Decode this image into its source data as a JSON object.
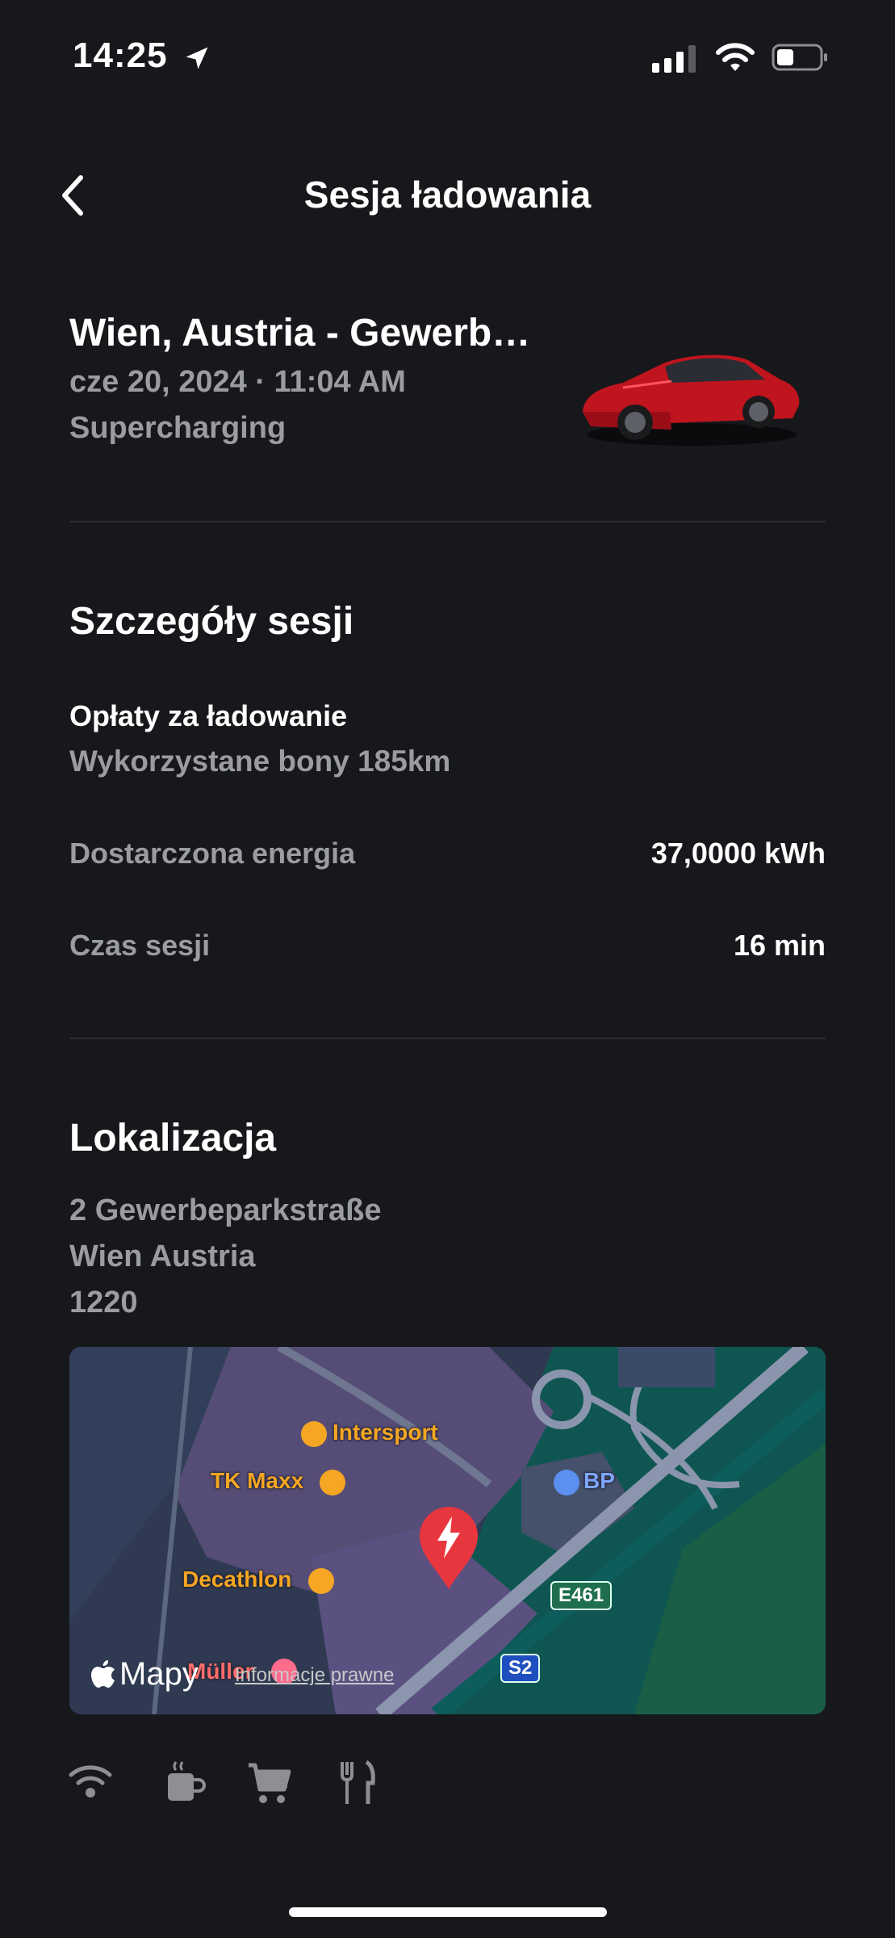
{
  "status_bar": {
    "time": "14:25"
  },
  "header": {
    "title": "Sesja ładowania"
  },
  "summary": {
    "location": "Wien, Austria - Gewerb…",
    "datetime": "cze 20, 2024 · 11:04 AM",
    "type": "Supercharging"
  },
  "session": {
    "title": "Szczegóły sesji",
    "fees_title": "Opłaty za ładowanie",
    "fees_detail": "Wykorzystane bony 185km",
    "rows": [
      {
        "label": "Dostarczona energia",
        "value": "37,0000 kWh"
      },
      {
        "label": "Czas sesji",
        "value": "16 min"
      }
    ]
  },
  "location": {
    "title": "Lokalizacja",
    "address_lines": [
      "2 Gewerbeparkstraße",
      "Wien Austria",
      "1220"
    ]
  },
  "map": {
    "pois": [
      "Intersport",
      "TK Maxx",
      "Decathlon",
      "Müller",
      "BP"
    ],
    "road_badges": [
      "E461",
      "S2"
    ],
    "brand": "Mapy",
    "legal": "Informacje prawne",
    "colors": {
      "pin": "#e8363e",
      "poi": "#f5a623",
      "bp": "#5b8ff0"
    }
  },
  "amenities": [
    "wifi-icon",
    "coffee-icon",
    "cart-icon",
    "restaurant-icon"
  ]
}
